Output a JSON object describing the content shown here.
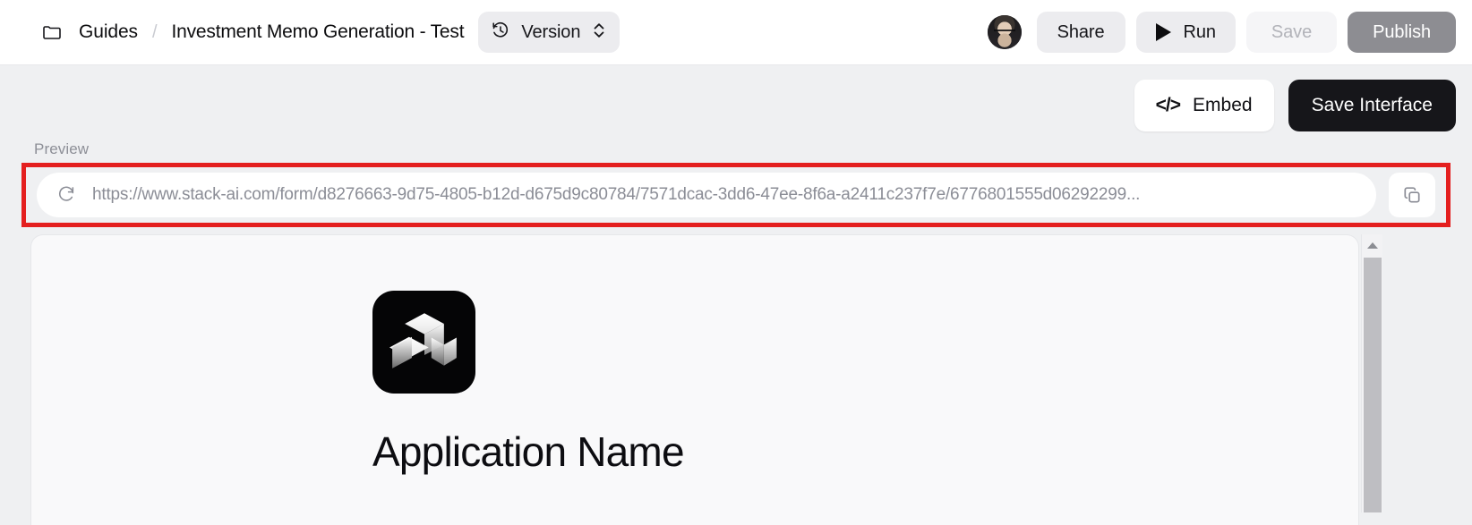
{
  "header": {
    "folder_icon": "folder-icon",
    "breadcrumb": {
      "root": "Guides",
      "separator": "/",
      "current": "Investment Memo Generation - Test"
    },
    "version_selector": {
      "icon": "history-clock-icon",
      "label": "Version",
      "chevron": "chevron-up-down-icon"
    },
    "avatar": "user-avatar",
    "buttons": {
      "share": "Share",
      "run": "Run",
      "save": "Save",
      "publish": "Publish"
    }
  },
  "action_row": {
    "embed": {
      "icon": "code-brackets-icon",
      "glyph": "</>",
      "label": "Embed"
    },
    "save_interface": "Save Interface"
  },
  "preview": {
    "section_label": "Preview",
    "url_bar": {
      "refresh_icon": "refresh-icon",
      "url": "https://www.stack-ai.com/form/d8276663-9d75-4805-b12d-d675d9c80784/7571dcac-3dd6-47ee-8f6a-a2411c237f7e/6776801555d06292299...",
      "copy_icon": "copy-icon"
    },
    "panel": {
      "logo": "stack-ai-cubes-logo",
      "app_name": "Application Name"
    },
    "scrollbar": {
      "up_arrow": "scroll-up-arrow-icon",
      "thumb": "scroll-thumb"
    }
  },
  "colors": {
    "highlight_red": "#e41f1f",
    "page_background": "#eff0f2",
    "header_background": "#ffffff",
    "dark_button": "#16161a",
    "publish_gray": "#8d8d92"
  }
}
